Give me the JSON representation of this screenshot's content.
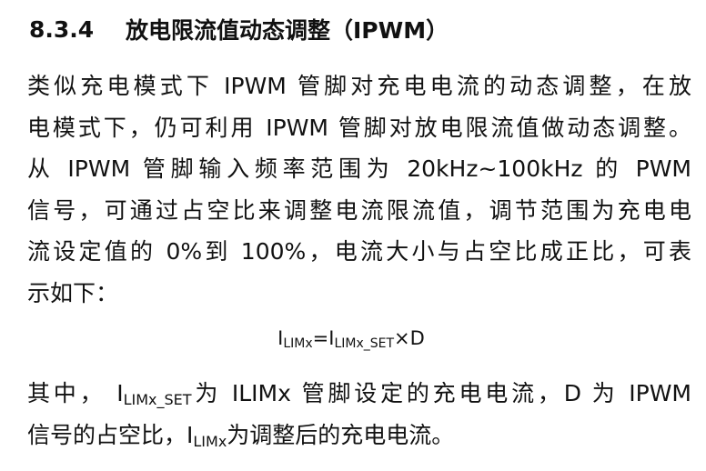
{
  "heading": {
    "number": "8.3.4",
    "title": "放电限流值动态调整（IPWM）"
  },
  "paragraph": {
    "lines": [
      "类似充电模式下 IPWM 管脚对充电电流的动态调整，在放",
      "电模式下，仍可利用 IPWM 管脚对放电限流值做动态调整。",
      "从 IPWM 管脚输入频率范围为 20kHz~100kHz 的 PWM",
      "信号，可通过占空比来调整电流限流值，调节范围为充电电",
      "流设定值的 0%到 100%，电流大小与占空比成正比，可表",
      "示如下："
    ]
  },
  "formula": {
    "lhs_main": "I",
    "lhs_sub": "LIMx",
    "equals": "=",
    "rhs_main": "I",
    "rhs_sub": "LIMx_SET",
    "times_d": "×D"
  },
  "where": {
    "line1_prefix": "其中，",
    "line1_var_main": "I",
    "line1_var_sub": "LIMx_SET",
    "line1_suffix": "为 ILIMx 管脚设定的充电电流，D 为 IPWM",
    "line2_prefix": "信号的占空比，",
    "line2_var_main": "I",
    "line2_var_sub": "LIMx",
    "line2_suffix": "为调整后的充电电流。"
  }
}
